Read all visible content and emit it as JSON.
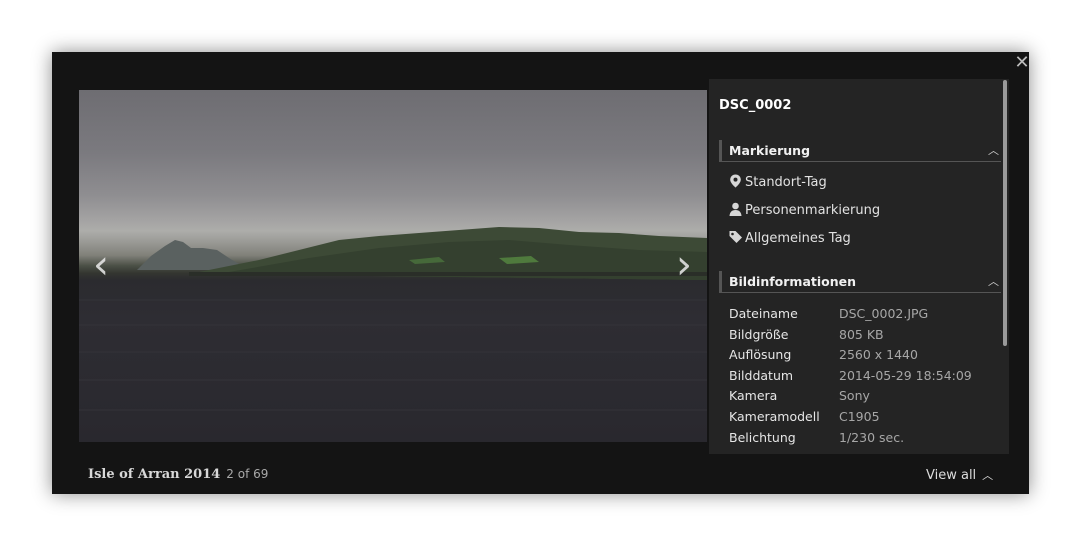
{
  "viewer": {
    "close_symbol": "✕",
    "prev_symbol": "‹",
    "next_symbol": "›"
  },
  "footer": {
    "album_title": "Isle of Arran 2014",
    "counter": "2 of 69",
    "view_all_label": "View all",
    "view_all_icon": "chevron-up-icon"
  },
  "panel": {
    "file_title": "DSC_0002",
    "tagging": {
      "heading": "Markierung",
      "items": [
        {
          "label": "Standort-Tag",
          "icon": "location-pin-icon"
        },
        {
          "label": "Personenmarkierung",
          "icon": "person-icon"
        },
        {
          "label": "Allgemeines Tag",
          "icon": "tag-icon"
        }
      ]
    },
    "info": {
      "heading": "Bildinformationen",
      "rows": [
        {
          "key": "Dateiname",
          "value": "DSC_0002.JPG"
        },
        {
          "key": "Bildgröße",
          "value": "805 KB"
        },
        {
          "key": "Auflösung",
          "value": "2560 x 1440"
        },
        {
          "key": "Bilddatum",
          "value": "2014-05-29 18:54:09"
        },
        {
          "key": "Kamera",
          "value": "Sony"
        },
        {
          "key": "Kameramodell",
          "value": "C1905"
        },
        {
          "key": "Belichtung",
          "value": "1/230 sec."
        }
      ]
    }
  },
  "colors": {
    "viewer_bg": "#141414",
    "panel_bg": "#242424",
    "info_value": "#a7a7a7"
  }
}
